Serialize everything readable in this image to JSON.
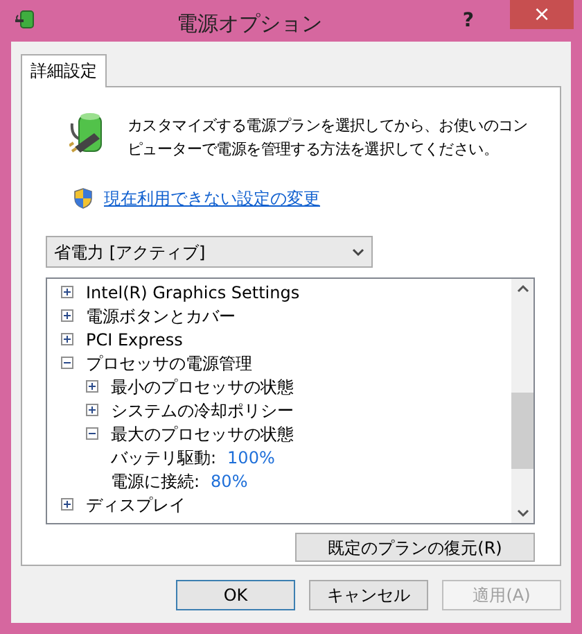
{
  "window": {
    "title": "電源オプション",
    "help": "?",
    "close": "×"
  },
  "tabs": [
    {
      "label": "詳細設定",
      "selected": true
    }
  ],
  "description": "カスタマイズする電源プランを選択してから、お使いのコンピューターで電源を管理する方法を選択してください。",
  "change_link": "現在利用できない設定の変更",
  "plan_select": {
    "value": "省電力 [アクティブ]"
  },
  "tree": [
    {
      "kind": "group",
      "label": "Intel(R) Graphics Settings",
      "expanded": false
    },
    {
      "kind": "group",
      "label": "電源ボタンとカバー",
      "expanded": false
    },
    {
      "kind": "group",
      "label": "PCI Express",
      "expanded": false
    },
    {
      "kind": "group",
      "label": "プロセッサの電源管理",
      "expanded": true,
      "children": [
        {
          "kind": "group",
          "label": "最小のプロセッサの状態",
          "expanded": false
        },
        {
          "kind": "group",
          "label": "システムの冷却ポリシー",
          "expanded": false
        },
        {
          "kind": "group",
          "label": "最大のプロセッサの状態",
          "expanded": true,
          "children": [
            {
              "kind": "setting",
              "label": "バッテリ駆動:",
              "value": "100%"
            },
            {
              "kind": "setting",
              "label": "電源に接続:",
              "value": "80%"
            }
          ]
        }
      ]
    },
    {
      "kind": "group",
      "label": "ディスプレイ",
      "expanded": false
    }
  ],
  "restore_button": "既定のプランの復元(R)",
  "buttons": [
    {
      "label": "OK",
      "disabled": false,
      "default": true
    },
    {
      "label": "キャンセル",
      "disabled": false,
      "default": false
    },
    {
      "label": "適用(A)",
      "disabled": true,
      "default": false
    }
  ]
}
